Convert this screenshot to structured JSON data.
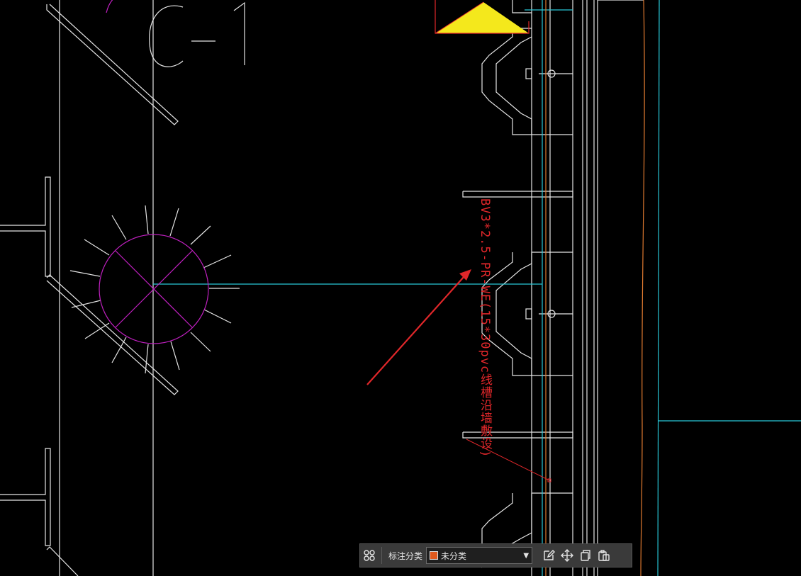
{
  "annotation": {
    "text": "BV3*2.5-PR-WE(15*30pvc线槽沿墙敷设)"
  },
  "toolbar": {
    "category_label": "标注分类",
    "category_value": "未分类",
    "category_color": "#e05a1e"
  },
  "colors": {
    "background": "#000000",
    "cyan": "#28c8d8",
    "magenta": "#c020c0",
    "yellow": "#f4e81c",
    "red": "#e0272a",
    "orange": "#e07a30",
    "white": "#e6e6e6"
  },
  "icons": [
    "group-icon",
    "edit-icon",
    "move-icon",
    "copy-icon",
    "paste-icon"
  ]
}
